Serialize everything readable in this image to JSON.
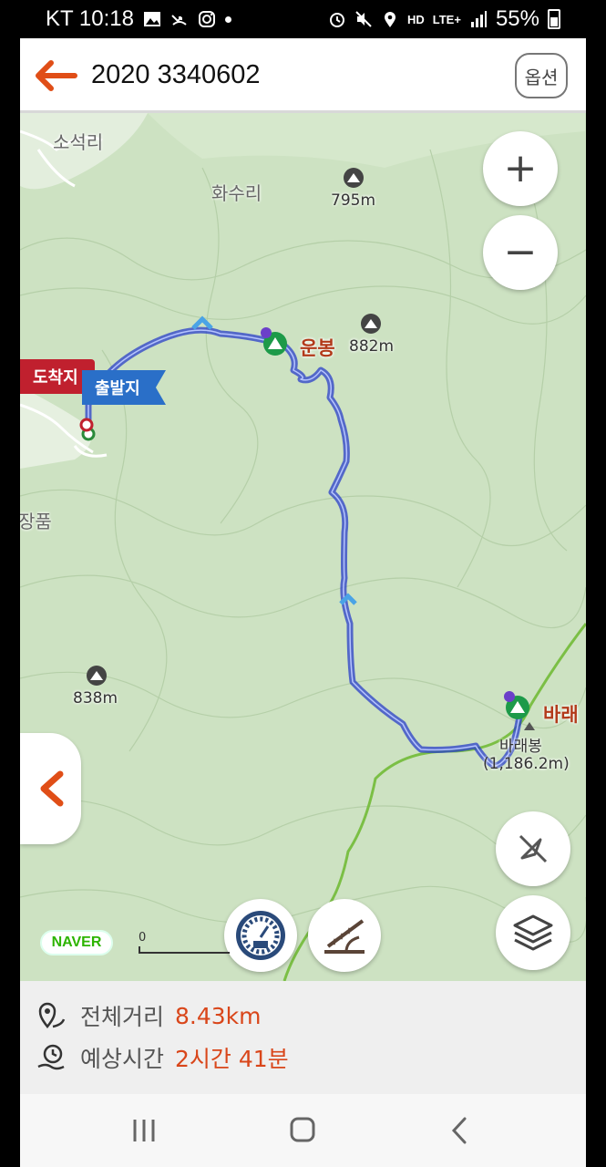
{
  "status_bar": {
    "carrier_time": "KT 10:18",
    "network": "LTE+",
    "hd": "HD",
    "battery": "55%"
  },
  "header": {
    "title": "2020 3340602",
    "option_label": "옵션"
  },
  "map": {
    "places": [
      "소석리",
      "화수리",
      "장품"
    ],
    "peaks": [
      {
        "name": "운봉",
        "elevation": "882m"
      },
      {
        "name": "바래",
        "elevation": ""
      },
      {
        "name": "",
        "elevation": "795m"
      },
      {
        "name": "",
        "elevation": "838m"
      }
    ],
    "small_peak_label": "바래봉",
    "small_peak_elev": "(1,186.2m)",
    "flags": {
      "arrival": "도착지",
      "departure": "출발지"
    },
    "naver_logo": "NAVER",
    "scale_label": "0",
    "zoom_in": "+",
    "zoom_out": "−"
  },
  "info": {
    "distance_label": "전체거리",
    "distance_value": "8.43km",
    "time_label": "예상시간",
    "time_value": "2시간 41분"
  },
  "colors": {
    "accent": "#d9461a",
    "route": "#2a3fc9",
    "map_bg": "#cde2c2",
    "flag_arrival": "#c0202e",
    "flag_departure": "#2a6fc8"
  }
}
